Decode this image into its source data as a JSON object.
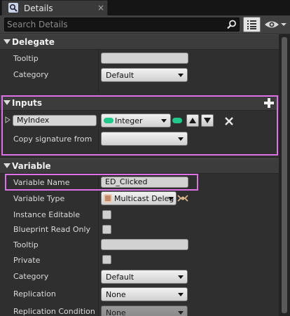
{
  "tab": {
    "title": "Details",
    "close_glyph": "×",
    "icon": "details-magnifier-icon"
  },
  "search": {
    "placeholder": "Search Details",
    "value": ""
  },
  "toolbar": {
    "list_view_icon": "list-view-icon",
    "visibility_icon": "eye-icon"
  },
  "categories": {
    "delegate": {
      "label": "Delegate",
      "tooltip_label": "Tooltip",
      "tooltip_value": "",
      "category_label": "Category",
      "category_value": "Default"
    },
    "inputs": {
      "label": "Inputs",
      "add_icon": "plus-icon",
      "param_name": "MyIndex",
      "param_type": "Integer",
      "type_color": "#1ec98a",
      "copy_label": "Copy signature from",
      "copy_value": ""
    },
    "variable": {
      "label": "Variable",
      "name_label": "Variable Name",
      "name_value": "ED_Clicked",
      "type_label": "Variable Type",
      "type_value": "Multicast Deleg",
      "instance_editable_label": "Instance Editable",
      "blueprint_read_only_label": "Blueprint Read Only",
      "tooltip_label": "Tooltip",
      "tooltip_value": "",
      "private_label": "Private",
      "category_label": "Category",
      "category_value": "Default",
      "replication_label": "Replication",
      "replication_value": "None",
      "replication_condition_label": "Replication Condition",
      "replication_condition_value": "None"
    }
  },
  "colors": {
    "highlight": "#e070e8",
    "panel": "#2f2f2f",
    "category": "#3c3c3c"
  }
}
